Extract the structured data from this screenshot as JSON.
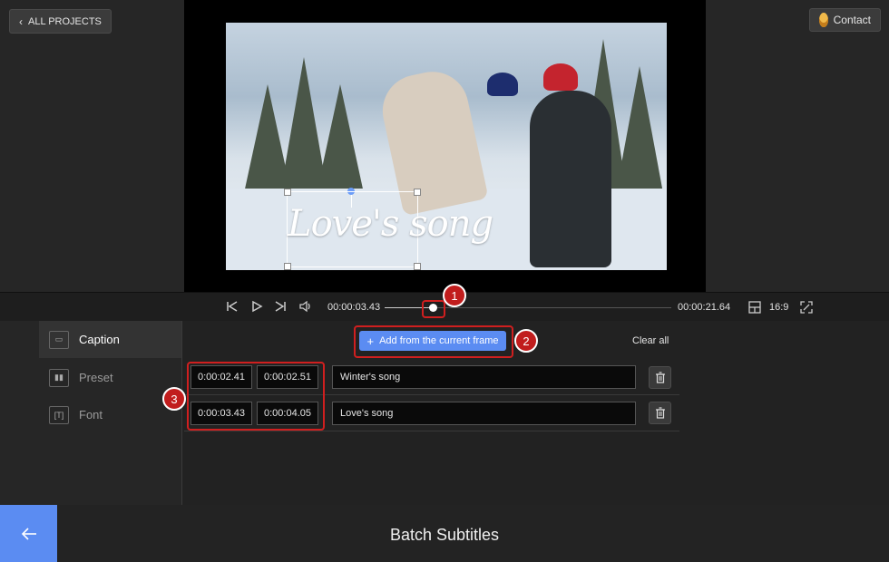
{
  "header": {
    "back_label": "ALL PROJECTS",
    "contact_label": "Contact"
  },
  "preview": {
    "caption_text": "Love's song"
  },
  "player": {
    "current_time": "00:00:03.43",
    "total_time": "00:00:21.64",
    "aspect_ratio": "16:9",
    "progress": 0.1585
  },
  "annotations": [
    "1",
    "2",
    "3"
  ],
  "sidebar": {
    "items": [
      {
        "label": "Caption",
        "icon": "caption-icon",
        "active": true
      },
      {
        "label": "Preset",
        "icon": "preset-icon",
        "active": false
      },
      {
        "label": "Font",
        "icon": "font-icon",
        "active": false
      }
    ]
  },
  "toolbar": {
    "add_label": "Add from the current frame",
    "clear_label": "Clear all"
  },
  "subtitles": [
    {
      "start": "0:00:02.41",
      "end": "0:00:02.51",
      "text": "Winter's song"
    },
    {
      "start": "0:00:03.43",
      "end": "0:00:04.05",
      "text": "Love's song"
    }
  ],
  "footer": {
    "title": "Batch Subtitles"
  },
  "colors": {
    "accent": "#5b8cf2",
    "annotation": "#c11d1d",
    "background": "#232323"
  }
}
